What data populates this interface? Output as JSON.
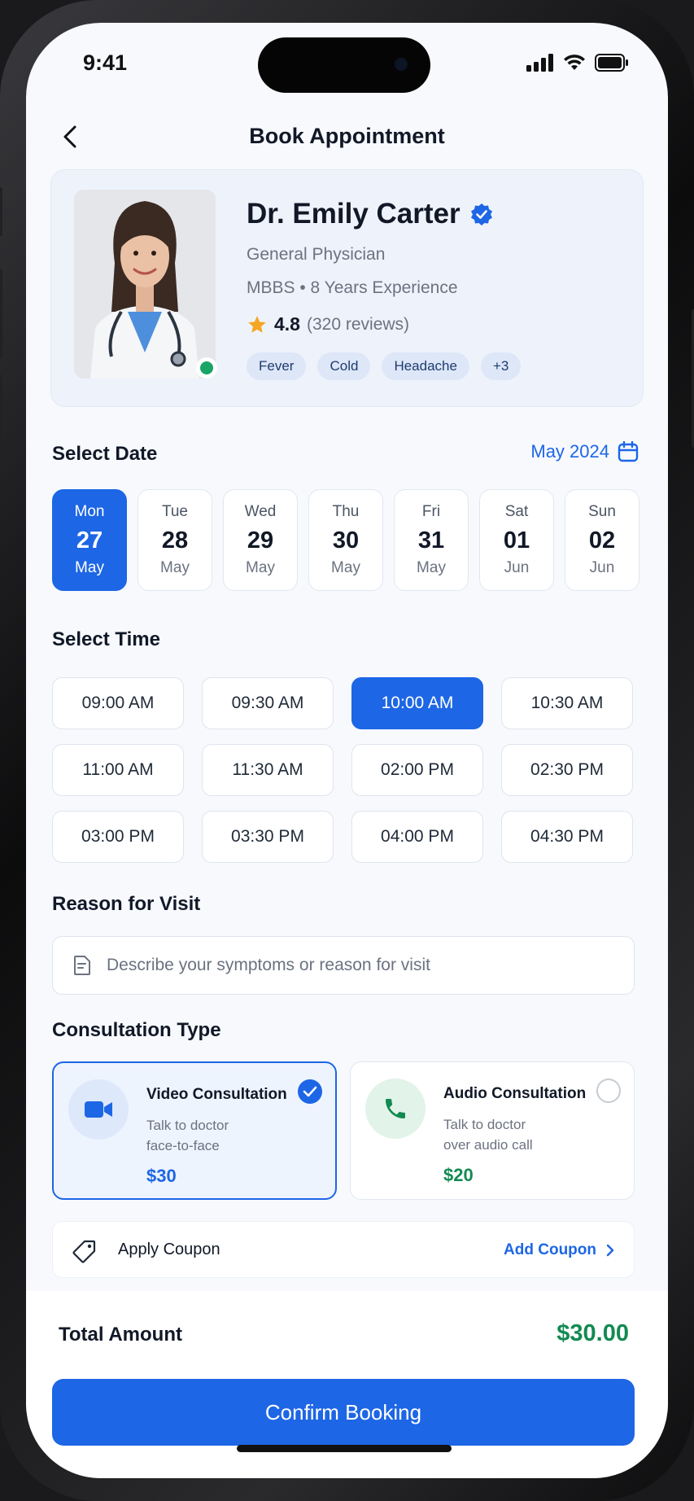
{
  "status_bar": {
    "time": "9:41"
  },
  "header": {
    "title": "Book Appointment"
  },
  "doctor": {
    "name": "Dr. Emily Carter",
    "specialty": "General Physician",
    "experience": "MBBS • 8 Years Experience",
    "rating": "4.8",
    "reviews": "(320 reviews)",
    "tags": [
      "Fever",
      "Cold",
      "Headache",
      "+3"
    ],
    "online_status_color": "#18a566"
  },
  "select_date": {
    "title": "Select Date",
    "month": "May 2024",
    "dates": [
      {
        "weekday": "Mon",
        "day": "27",
        "month": "May",
        "selected": true
      },
      {
        "weekday": "Tue",
        "day": "28",
        "month": "May",
        "selected": false
      },
      {
        "weekday": "Wed",
        "day": "29",
        "month": "May",
        "selected": false
      },
      {
        "weekday": "Thu",
        "day": "30",
        "month": "May",
        "selected": false
      },
      {
        "weekday": "Fri",
        "day": "31",
        "month": "May",
        "selected": false
      },
      {
        "weekday": "Sat",
        "day": "01",
        "month": "Jun",
        "selected": false
      },
      {
        "weekday": "Sun",
        "day": "02",
        "month": "Jun",
        "selected": false
      }
    ]
  },
  "select_time": {
    "title": "Select Time",
    "slots": [
      {
        "label": "09:00 AM",
        "selected": false
      },
      {
        "label": "09:30 AM",
        "selected": false
      },
      {
        "label": "10:00 AM",
        "selected": true
      },
      {
        "label": "10:30 AM",
        "selected": false
      },
      {
        "label": "11:00 AM",
        "selected": false
      },
      {
        "label": "11:30 AM",
        "selected": false
      },
      {
        "label": "02:00 PM",
        "selected": false
      },
      {
        "label": "02:30 PM",
        "selected": false
      },
      {
        "label": "03:00 PM",
        "selected": false
      },
      {
        "label": "03:30 PM",
        "selected": false
      },
      {
        "label": "04:00 PM",
        "selected": false
      },
      {
        "label": "04:30 PM",
        "selected": false
      }
    ]
  },
  "reason": {
    "title": "Reason for Visit",
    "placeholder": "Describe your symptoms or reason for visit",
    "value": ""
  },
  "consultation": {
    "title": "Consultation Type",
    "options": [
      {
        "title": "Video Consultation",
        "desc_line1": "Talk to doctor",
        "desc_line2": "face-to-face",
        "price": "$30",
        "icon": "video-camera-icon",
        "selected": true,
        "price_color": "#1d66e5"
      },
      {
        "title": "Audio Consultation",
        "desc_line1": "Talk to doctor",
        "desc_line2": "over audio call",
        "price": "$20",
        "icon": "phone-icon",
        "selected": false,
        "price_color": "#138a52"
      }
    ]
  },
  "coupon": {
    "label": "Apply Coupon",
    "action": "Add Coupon"
  },
  "footer": {
    "total_label": "Total Amount",
    "total_value": "$30.00",
    "confirm_label": "Confirm Booking"
  },
  "colors": {
    "accent": "#1d66e5",
    "success": "#138a52",
    "star": "#f5a623"
  }
}
